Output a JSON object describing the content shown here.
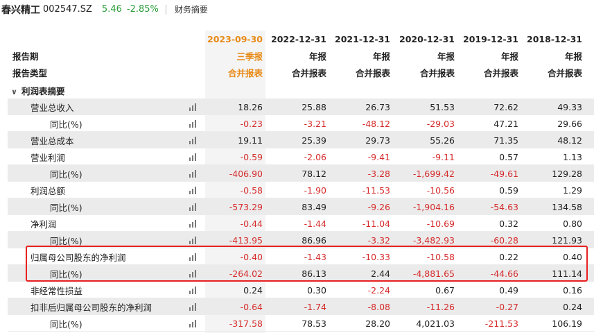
{
  "header": {
    "stock_name": "春兴精工",
    "stock_code": "002547.SZ",
    "price": "5.46",
    "change_pct": "-2.85%",
    "section_title": "财务摘要"
  },
  "table": {
    "row_labels": {
      "period": "报告期",
      "report_type": "报告类型"
    },
    "columns": [
      {
        "date": "2023-09-30",
        "period_type": "三季报",
        "report_type": "合并报表"
      },
      {
        "date": "2022-12-31",
        "period_type": "年报",
        "report_type": "合并报表"
      },
      {
        "date": "2021-12-31",
        "period_type": "年报",
        "report_type": "合并报表"
      },
      {
        "date": "2020-12-31",
        "period_type": "年报",
        "report_type": "合并报表"
      },
      {
        "date": "2019-12-31",
        "period_type": "年报",
        "report_type": "合并报表"
      },
      {
        "date": "2018-12-31",
        "period_type": "年报",
        "report_type": "合并报表"
      }
    ],
    "section_label": "利润表摘要",
    "rows": [
      {
        "label": "营业总收入",
        "indent": 1,
        "values": [
          "18.26",
          "25.88",
          "26.73",
          "51.53",
          "72.62",
          "49.33"
        ]
      },
      {
        "label": "同比(%)",
        "indent": 2,
        "values": [
          "-0.23",
          "-3.21",
          "-48.12",
          "-29.03",
          "47.21",
          "29.66"
        ]
      },
      {
        "label": "营业总成本",
        "indent": 1,
        "values": [
          "19.11",
          "25.39",
          "29.73",
          "55.26",
          "71.35",
          "48.12"
        ]
      },
      {
        "label": "营业利润",
        "indent": 1,
        "values": [
          "-0.59",
          "-2.06",
          "-9.41",
          "-9.11",
          "0.57",
          "1.13"
        ]
      },
      {
        "label": "同比(%)",
        "indent": 2,
        "values": [
          "-406.90",
          "78.12",
          "-3.28",
          "-1,699.42",
          "-49.61",
          "129.28"
        ]
      },
      {
        "label": "利润总额",
        "indent": 1,
        "values": [
          "-0.58",
          "-1.90",
          "-11.53",
          "-10.56",
          "0.59",
          "1.29"
        ]
      },
      {
        "label": "同比(%)",
        "indent": 2,
        "values": [
          "-573.29",
          "83.49",
          "-9.26",
          "-1,904.16",
          "-54.63",
          "134.58"
        ]
      },
      {
        "label": "净利润",
        "indent": 1,
        "values": [
          "-0.44",
          "-1.44",
          "-11.04",
          "-10.69",
          "0.32",
          "0.80"
        ]
      },
      {
        "label": "同比(%)",
        "indent": 2,
        "values": [
          "-413.95",
          "86.96",
          "-3.32",
          "-3,482.93",
          "-60.28",
          "121.93"
        ]
      },
      {
        "label": "归属母公司股东的净利润",
        "indent": 1,
        "values": [
          "-0.40",
          "-1.43",
          "-10.33",
          "-10.58",
          "0.22",
          "0.40"
        ]
      },
      {
        "label": "同比(%)",
        "indent": 2,
        "values": [
          "-264.02",
          "86.13",
          "2.44",
          "-4,881.65",
          "-44.66",
          "111.14"
        ]
      },
      {
        "label": "非经常性损益",
        "indent": 1,
        "values": [
          "0.24",
          "0.30",
          "-2.24",
          "0.67",
          "0.49",
          "0.16"
        ]
      },
      {
        "label": "扣非后归属母公司股东的净利润",
        "indent": 1,
        "values": [
          "-0.64",
          "-1.74",
          "-8.08",
          "-11.26",
          "-0.27",
          "0.24"
        ]
      },
      {
        "label": "同比(%)",
        "indent": 2,
        "values": [
          "-317.58",
          "78.53",
          "28.20",
          "4,021.03",
          "-211.53",
          "106.19"
        ]
      }
    ]
  },
  "colors": {
    "up": "#d62b2b",
    "down": "#2a9d3a",
    "latest_period": "#e88a16",
    "highlight_border": "#e82020"
  },
  "icons": {
    "row_chart": "bar-chart-icon",
    "section_toggle": "chevron-down-icon"
  }
}
